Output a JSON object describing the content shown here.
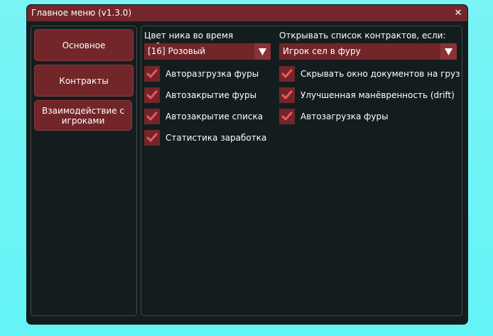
{
  "window": {
    "title": "Главное меню (v1.3.0)",
    "close_glyph": "✕"
  },
  "sidebar": {
    "items": [
      {
        "label": "Основное"
      },
      {
        "label": "Контракты"
      },
      {
        "label": "Взаимодействие с игроками"
      }
    ]
  },
  "left_column": {
    "label": "Цвет ника во время работы:",
    "dropdown_value": "[16] Розовый",
    "checkboxes": [
      {
        "label": "Авторазгрузка фуры",
        "checked": true
      },
      {
        "label": "Автозакрытие фуры",
        "checked": true
      },
      {
        "label": "Автозакрытие списка",
        "checked": true
      },
      {
        "label": "Статистика заработка",
        "checked": true
      }
    ]
  },
  "right_column": {
    "label": "Открывать список контрактов, если:",
    "dropdown_value": "Игрок сел в фуру",
    "checkboxes": [
      {
        "label": "Скрывать окно документов на груз",
        "checked": true
      },
      {
        "label": "Улучшенная манёвренность (drift)",
        "checked": true
      },
      {
        "label": "Автозагрузка фуры",
        "checked": true
      }
    ]
  },
  "colors": {
    "background": "#6ff4f6",
    "window_bg": "#141d1e",
    "accent": "#73262a",
    "check": "#f05560",
    "text": "#ffffff"
  },
  "icons": {
    "close": "close-icon",
    "dropdown": "triangle-down-icon",
    "checkbox": "checkmark-icon"
  }
}
